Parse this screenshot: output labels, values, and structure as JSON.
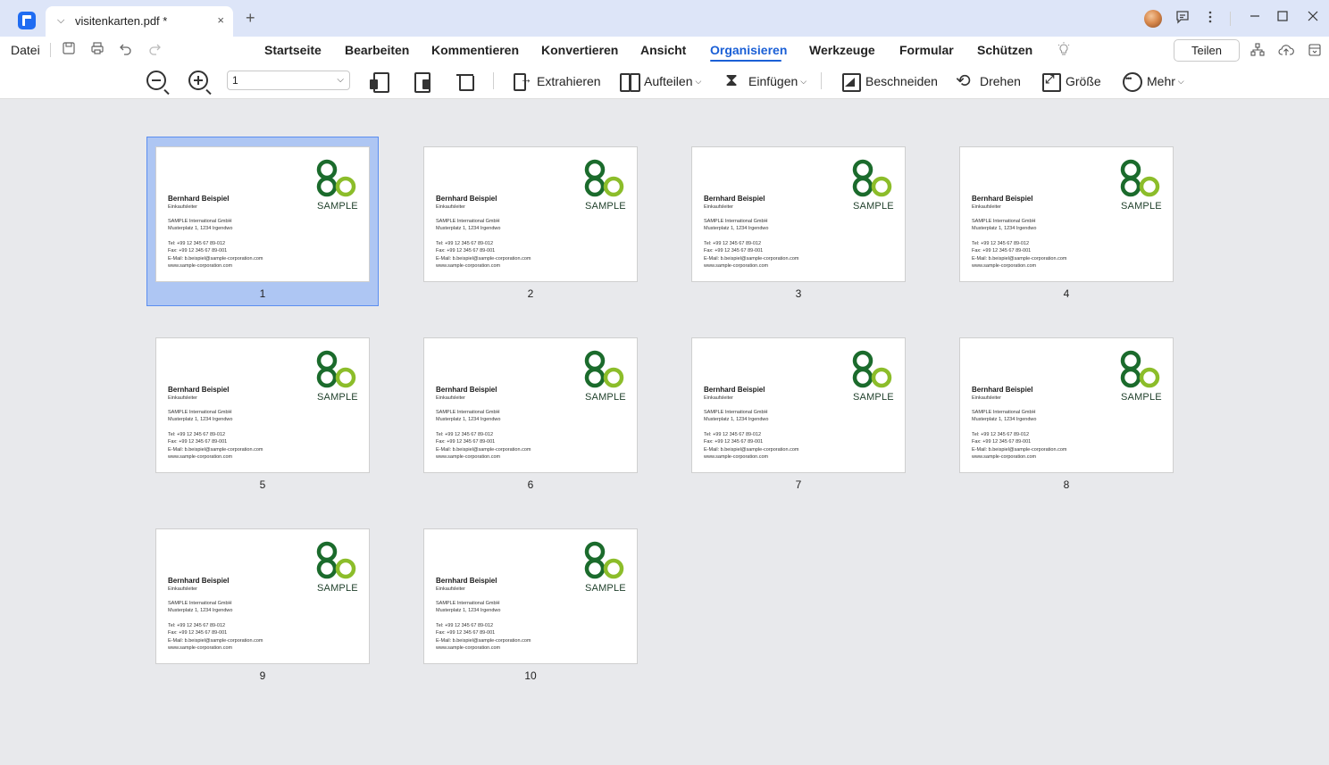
{
  "window": {
    "tab_title": "visitenkarten.pdf *",
    "tab_close_glyph": "×",
    "tab_chevron_glyph": "⌵",
    "new_tab_glyph": "+"
  },
  "menubar": {
    "file_label": "Datei",
    "items": [
      "Startseite",
      "Bearbeiten",
      "Kommentieren",
      "Konvertieren",
      "Ansicht",
      "Organisieren",
      "Werkzeuge",
      "Formular",
      "Schützen"
    ],
    "active": "Organisieren",
    "share_label": "Teilen"
  },
  "toolbar": {
    "page_value": "1",
    "extract_label": "Extrahieren",
    "split_label": "Aufteilen",
    "insert_label": "Einfügen",
    "crop_label": "Beschneiden",
    "rotate_label": "Drehen",
    "size_label": "Größe",
    "more_label": "Mehr"
  },
  "card": {
    "name": "Bernhard Beispiel",
    "role": "Einkaufsleiter",
    "company": "SAMPLE International GmbH",
    "address": "Musterplatz 1, 1234 Irgendwo",
    "tel": "Tel: +99 12 345 67 89-012",
    "fax": "Fax: +99 12 345 67 89-001",
    "email": "E-Mail: b.beispiel@sample-corporation.com",
    "web": "www.sample-corporation.com",
    "logo_text": "SAMPLE"
  },
  "pages": [
    {
      "number": "1",
      "selected": true
    },
    {
      "number": "2",
      "selected": false
    },
    {
      "number": "3",
      "selected": false
    },
    {
      "number": "4",
      "selected": false
    },
    {
      "number": "5",
      "selected": false
    },
    {
      "number": "6",
      "selected": false
    },
    {
      "number": "7",
      "selected": false
    },
    {
      "number": "8",
      "selected": false
    },
    {
      "number": "9",
      "selected": false
    },
    {
      "number": "10",
      "selected": false
    }
  ],
  "colors": {
    "accent": "#1a5fd6",
    "selection": "#aec6f3",
    "logo_dark_green": "#1b6b2c",
    "logo_light_green": "#8cbd2a"
  }
}
